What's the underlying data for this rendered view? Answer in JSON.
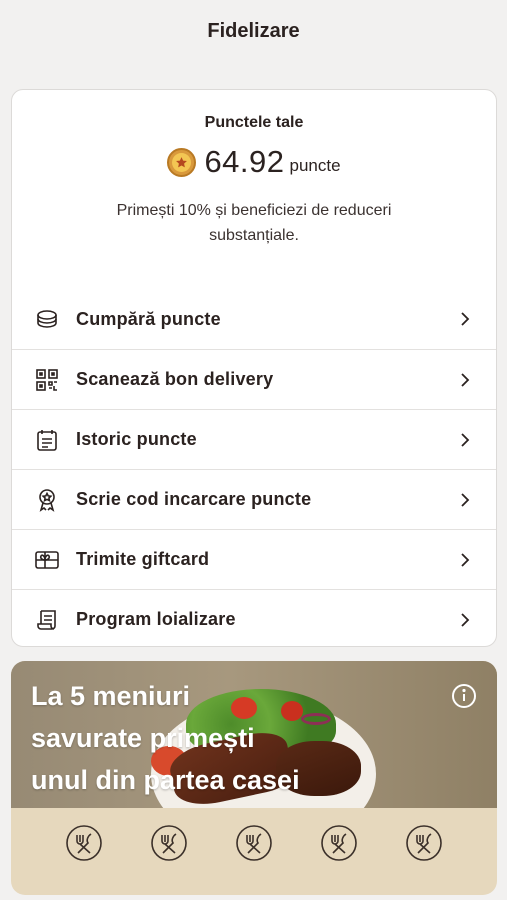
{
  "header": {
    "title": "Fidelizare"
  },
  "points": {
    "label": "Punctele tale",
    "value": "64.92",
    "unit": "puncte",
    "description": "Primești 10% și beneficiezi de reduceri substanțiale.",
    "coin_icon": "coin-star-icon"
  },
  "menu": [
    {
      "label": "Cumpără puncte",
      "icon": "coins-icon"
    },
    {
      "label": "Scanează bon delivery",
      "icon": "qr-code-icon"
    },
    {
      "label": "Istoric puncte",
      "icon": "calendar-list-icon"
    },
    {
      "label": "Scrie cod incarcare puncte",
      "icon": "award-badge-icon"
    },
    {
      "label": "Trimite giftcard",
      "icon": "gift-card-icon"
    },
    {
      "label": "Program loializare",
      "icon": "receipt-scroll-icon"
    }
  ],
  "promo": {
    "text": "La 5 meniuri\nsavurate primești\nunul din partea casei",
    "stamps_collected": 0,
    "stamps_total": 5,
    "stamp_icon": "fork-knife-icon",
    "info_icon": "info-icon"
  },
  "colors": {
    "background": "#f2f1f0",
    "text": "#2b2220",
    "card": "#ffffff",
    "promo_bottom": "#e6d8bd",
    "coin": "#d9993c"
  }
}
